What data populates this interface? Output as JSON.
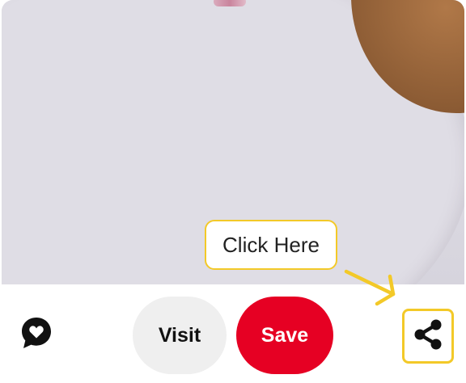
{
  "pin": {
    "image_alt": "Pin image"
  },
  "actions": {
    "visit_label": "Visit",
    "save_label": "Save"
  },
  "callout": {
    "text": "Click Here"
  },
  "icons": {
    "react": "heart-speech-bubble-icon",
    "share": "share-icon",
    "arrow": "arrow-down-right-icon"
  },
  "colors": {
    "save": "#e60023",
    "visit": "#efefef",
    "highlight": "#f3c928",
    "icon": "#111111"
  }
}
